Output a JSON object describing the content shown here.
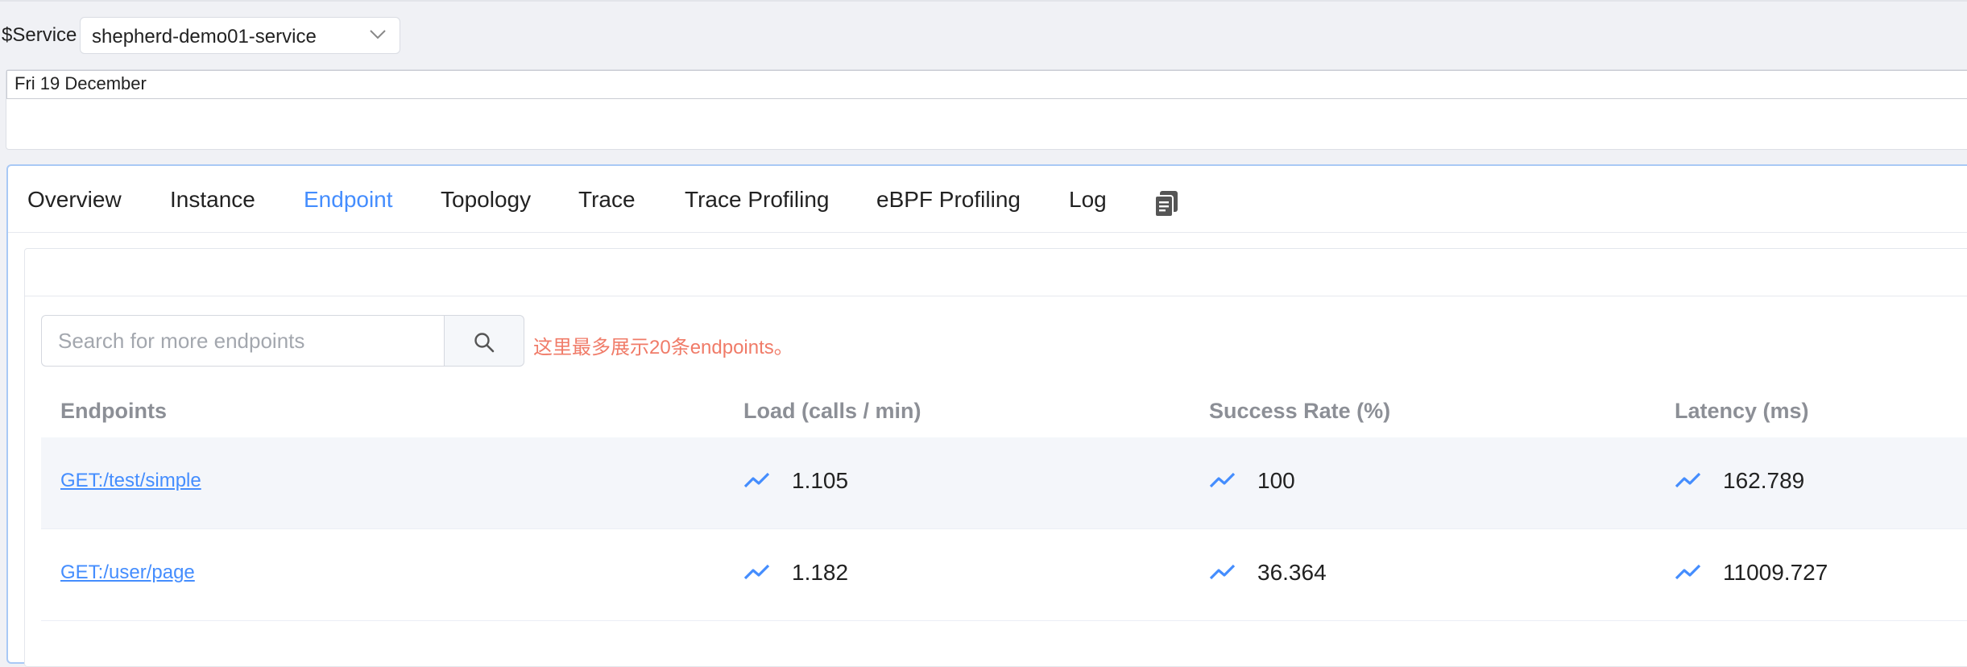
{
  "filter": {
    "service_label": "$Service",
    "service_value": "shepherd-demo01-service"
  },
  "date_panel": {
    "date": "Fri 19 December"
  },
  "tabs": [
    {
      "label": "Overview"
    },
    {
      "label": "Instance"
    },
    {
      "label": "Endpoint",
      "active": true
    },
    {
      "label": "Topology"
    },
    {
      "label": "Trace"
    },
    {
      "label": "Trace Profiling"
    },
    {
      "label": "eBPF Profiling"
    },
    {
      "label": "Log"
    }
  ],
  "tab_icon": "document-copy-icon",
  "search": {
    "placeholder": "Search for more endpoints",
    "icon": "search-icon",
    "hint": "这里最多展示20条endpoints。"
  },
  "table": {
    "columns": [
      "Endpoints",
      "Load (calls / min)",
      "Success Rate (%)",
      "Latency (ms)"
    ],
    "metric_icon": "trend-line-icon",
    "rows": [
      {
        "endpoint": "GET:/test/simple",
        "load": "1.105",
        "success_rate": "100",
        "latency": "162.789"
      },
      {
        "endpoint": "GET:/user/page",
        "load": "1.182",
        "success_rate": "36.364",
        "latency": "11009.727"
      }
    ]
  },
  "colors": {
    "accent": "#448dfe",
    "hint": "#f07b68",
    "header_text": "#8c8f96"
  }
}
